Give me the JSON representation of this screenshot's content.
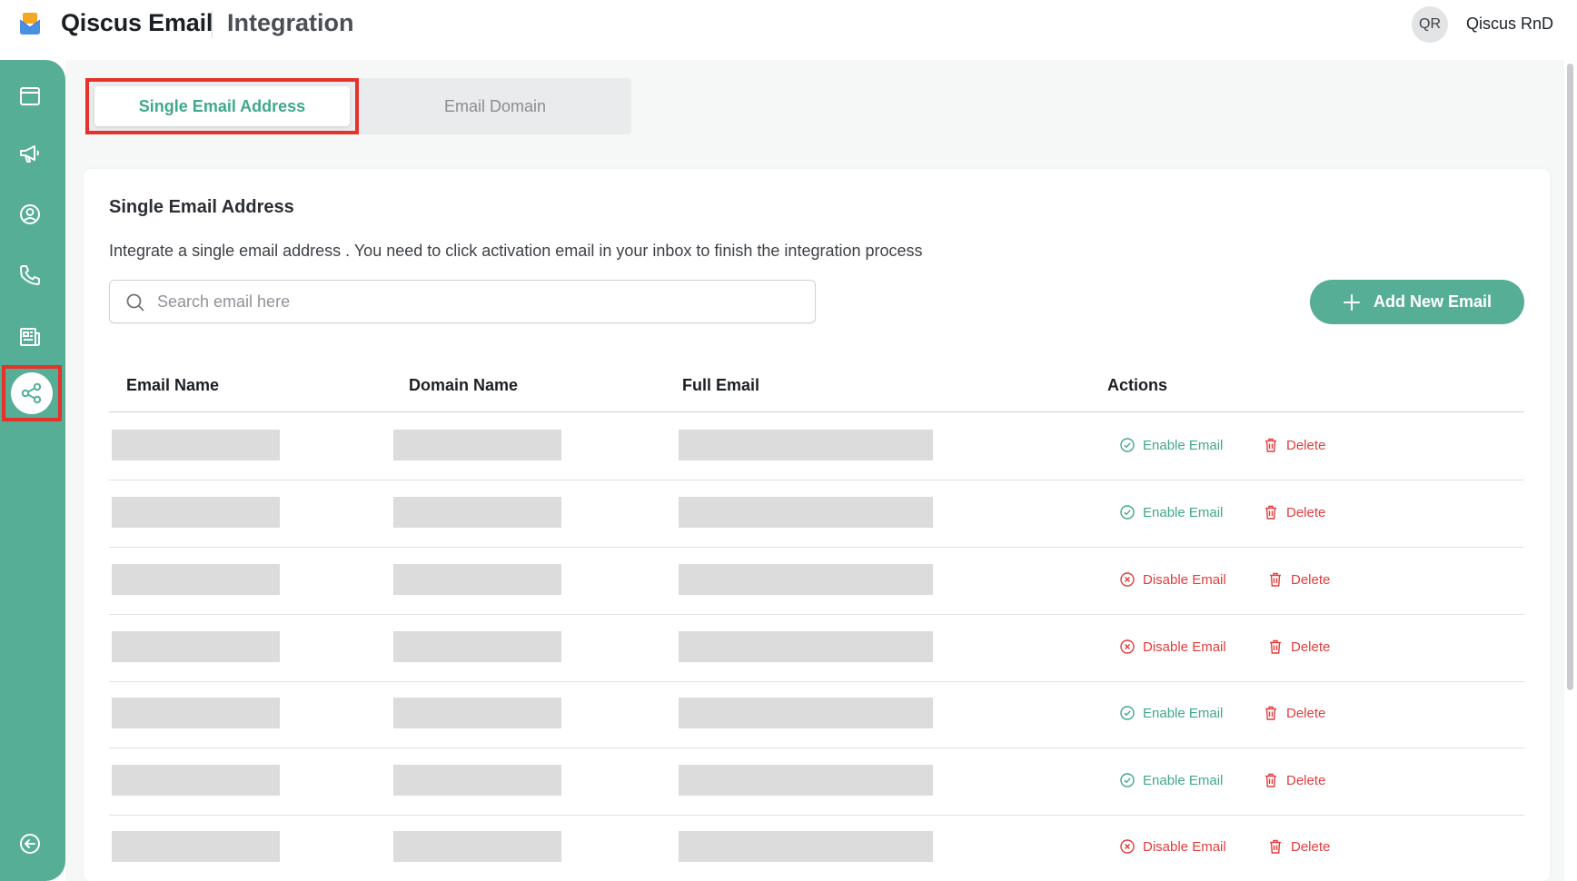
{
  "header": {
    "app_name": "Qiscus Email",
    "page_title": "Integration",
    "avatar_initials": "QR",
    "user_name": "Qiscus RnD"
  },
  "sidebar": {
    "items": [
      {
        "icon": "window-icon"
      },
      {
        "icon": "megaphone-icon"
      },
      {
        "icon": "user-circle-icon"
      },
      {
        "icon": "phone-icon"
      },
      {
        "icon": "newspaper-icon"
      },
      {
        "icon": "share-icon",
        "active": true
      }
    ],
    "collapse_icon": "arrow-left-circle-icon",
    "color": "#56ae97"
  },
  "tabs": [
    {
      "label": "Single Email Address",
      "active": true
    },
    {
      "label": "Email Domain",
      "active": false
    }
  ],
  "section": {
    "title": "Single Email Address",
    "description": "Integrate a single email address . You need to click activation email in your inbox to finish the integration process"
  },
  "search": {
    "placeholder": "Search email here",
    "value": ""
  },
  "add_button": {
    "label": "Add New Email"
  },
  "table": {
    "columns": [
      "Email Name",
      "Domain Name",
      "Full Email",
      "Actions"
    ],
    "rows": [
      {
        "toggle_label": "Enable Email",
        "toggle_type": "enable",
        "delete_label": "Delete"
      },
      {
        "toggle_label": "Enable Email",
        "toggle_type": "enable",
        "delete_label": "Delete"
      },
      {
        "toggle_label": "Disable Email",
        "toggle_type": "disable",
        "delete_label": "Delete"
      },
      {
        "toggle_label": "Disable Email",
        "toggle_type": "disable",
        "delete_label": "Delete"
      },
      {
        "toggle_label": "Enable Email",
        "toggle_type": "enable",
        "delete_label": "Delete"
      },
      {
        "toggle_label": "Enable Email",
        "toggle_type": "enable",
        "delete_label": "Delete"
      },
      {
        "toggle_label": "Disable Email",
        "toggle_type": "disable",
        "delete_label": "Delete"
      }
    ]
  },
  "colors": {
    "accent": "#56ae97",
    "accent_text": "#3fa88c",
    "danger": "#e23c3c",
    "highlight_border": "#e5322b"
  }
}
